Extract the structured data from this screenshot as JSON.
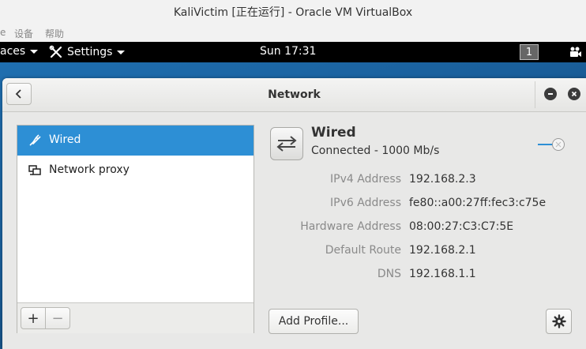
{
  "vbox": {
    "title": "KaliVictim [正在运行] - Oracle VM VirtualBox",
    "menu": [
      "设备",
      "帮助"
    ],
    "menu_partial": "e"
  },
  "topbar": {
    "places": "aces",
    "settings": "Settings",
    "clock": "Sun 17:31",
    "workspace": "1"
  },
  "window": {
    "title": "Network",
    "sidebar": {
      "items": [
        {
          "label": "Wired",
          "icon": "wired-icon",
          "selected": true
        },
        {
          "label": "Network proxy",
          "icon": "network-proxy-icon",
          "selected": false
        }
      ],
      "add_label": "+",
      "remove_label": "−"
    },
    "detail": {
      "name": "Wired",
      "status": "Connected - 1000 Mb/s",
      "enabled": true,
      "properties": [
        {
          "label": "IPv4 Address",
          "value": "192.168.2.3"
        },
        {
          "label": "IPv6 Address",
          "value": "fe80::a00:27ff:fec3:c75e"
        },
        {
          "label": "Hardware Address",
          "value": "08:00:27:C3:C7:5E"
        },
        {
          "label": "Default Route",
          "value": "192.168.2.1"
        },
        {
          "label": "DNS",
          "value": "192.168.1.1"
        }
      ],
      "add_profile_label": "Add Profile..."
    }
  },
  "colors": {
    "selection": "#2d8fd5",
    "topbar": "#000000",
    "desktop": "#1a5f9b"
  }
}
